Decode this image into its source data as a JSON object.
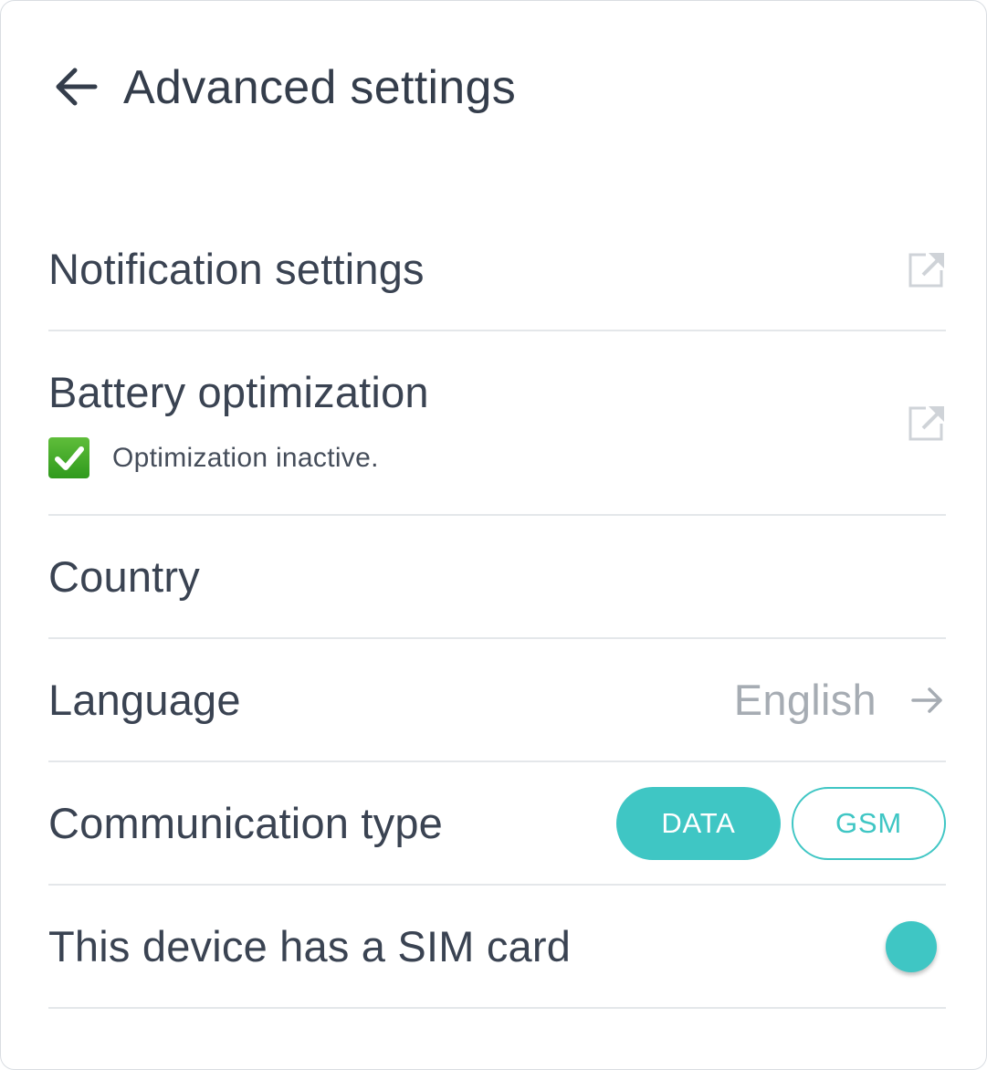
{
  "header": {
    "title": "Advanced settings"
  },
  "rows": {
    "notification": {
      "label": "Notification settings"
    },
    "battery": {
      "label": "Battery optimization",
      "status": "Optimization inactive."
    },
    "country": {
      "label": "Country"
    },
    "language": {
      "label": "Language",
      "value": "English"
    },
    "communication": {
      "label": "Communication type",
      "options": [
        "DATA",
        "GSM"
      ],
      "selected": "DATA"
    },
    "sim": {
      "label": "This device has a SIM card",
      "enabled": true
    }
  },
  "colors": {
    "accent": "#3fc6c4",
    "text": "#3a4352",
    "muted": "#a6acb3",
    "divider": "#e4e7ea",
    "check": "#3aa524"
  },
  "icons": [
    "arrow-left-icon",
    "external-link-icon",
    "check-icon",
    "arrow-right-icon"
  ]
}
